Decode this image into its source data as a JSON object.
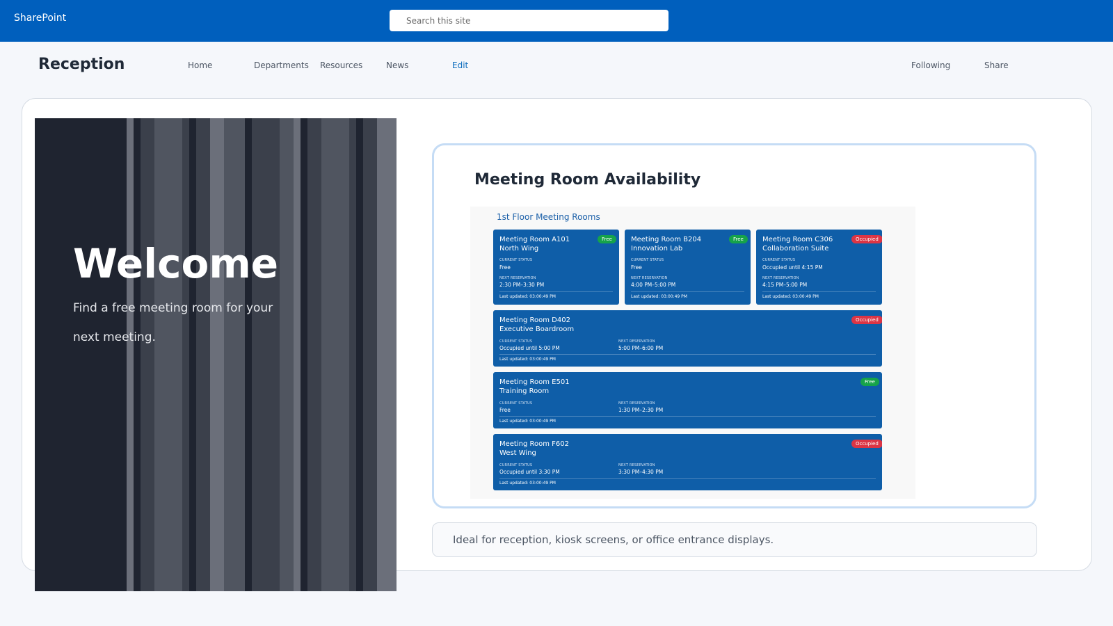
{
  "app": {
    "name": "SharePoint"
  },
  "search": {
    "placeholder": "Search this site",
    "value": ""
  },
  "site": {
    "title": "Reception"
  },
  "nav": [
    {
      "label": "Home"
    },
    {
      "label": "Departments"
    },
    {
      "label": "Resources"
    },
    {
      "label": "News"
    },
    {
      "label": "Edit"
    }
  ],
  "header_actions": {
    "following": "Following",
    "share": "Share"
  },
  "hero": {
    "title": "Welcome",
    "subtitle": "Find a free meeting room for your next meeting.",
    "stripe_colors": [
      "#6b6f7a",
      "#505560",
      "#3b404b"
    ]
  },
  "widget": {
    "title": "Meeting Room Availability",
    "floor_title": "1st Floor Meeting Rooms",
    "status_label": "CURRENT STATUS",
    "next_label": "NEXT RESERVATION",
    "rooms": [
      {
        "name": "Meeting Room A101",
        "location": "North Wing",
        "badge": "Free",
        "status": "Free",
        "next": "2:30 PM–3:30 PM",
        "updated": "Last updated: 03:00:49 PM"
      },
      {
        "name": "Meeting Room B204",
        "location": "Innovation Lab",
        "badge": "Free",
        "status": "Free",
        "next": "4:00 PM–5:00 PM",
        "updated": "Last updated: 03:00:49 PM"
      },
      {
        "name": "Meeting Room C306",
        "location": "Collaboration Suite",
        "badge": "Occupied",
        "status": "Occupied until 4:15 PM",
        "next": "4:15 PM–5:00 PM",
        "updated": "Last updated: 03:00:49 PM"
      },
      {
        "name": "Meeting Room D402",
        "location": "Executive Boardroom",
        "badge": "Occupied",
        "status": "Occupied until 5:00 PM",
        "next": "5:00 PM–6:00 PM",
        "updated": "Last updated: 03:00:49 PM"
      },
      {
        "name": "Meeting Room E501",
        "location": "Training Room",
        "badge": "Free",
        "status": "Free",
        "next": "1:30 PM–2:30 PM",
        "updated": "Last updated: 03:00:49 PM"
      },
      {
        "name": "Meeting Room F602",
        "location": "West Wing",
        "badge": "Occupied",
        "status": "Occupied until 3:30 PM",
        "next": "3:30 PM–4:30 PM",
        "updated": "Last updated: 03:00:49 PM"
      }
    ],
    "colors": {
      "card": "#0f5ea8",
      "free": "#16a34a",
      "occupied": "#dc3545"
    }
  },
  "footer": {
    "note": "Ideal for reception, kiosk screens, or office entrance displays."
  },
  "colors": {
    "app_bar": "#005fbd",
    "accent": "#0b6cbd"
  }
}
